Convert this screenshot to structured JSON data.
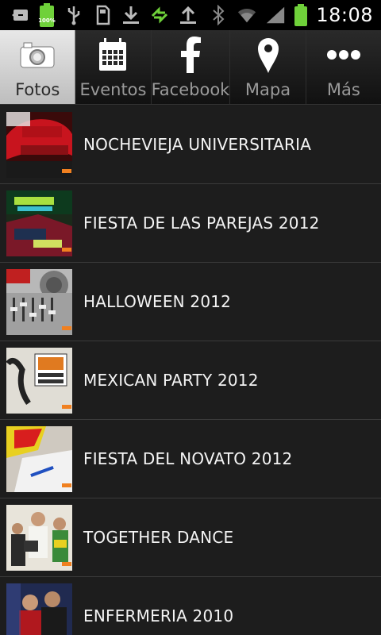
{
  "status_bar": {
    "time": "18:08",
    "battery_percent": "100%",
    "icons": [
      "back-arrow-icon",
      "battery-full-icon",
      "usb-icon",
      "sd-card-icon",
      "download-icon",
      "sync-icon",
      "upload-icon",
      "bluetooth-icon",
      "wifi-icon",
      "signal-icon",
      "battery-icon"
    ]
  },
  "tabs": [
    {
      "label": "Fotos",
      "icon": "camera-icon",
      "active": true
    },
    {
      "label": "Eventos",
      "icon": "calendar-icon",
      "active": false
    },
    {
      "label": "Facebook",
      "icon": "facebook-icon",
      "active": false
    },
    {
      "label": "Mapa",
      "icon": "map-pin-icon",
      "active": false
    },
    {
      "label": "Más",
      "icon": "more-dots-icon",
      "active": false
    }
  ],
  "albums": [
    {
      "title": "NOCHEVIEJA UNIVERSITARIA"
    },
    {
      "title": "FIESTA DE LAS PAREJAS 2012"
    },
    {
      "title": "HALLOWEEN 2012"
    },
    {
      "title": "MEXICAN PARTY 2012"
    },
    {
      "title": "FIESTA DEL NOVATO 2012"
    },
    {
      "title": "TOGETHER DANCE"
    },
    {
      "title": "ENFERMERIA 2010"
    }
  ],
  "colors": {
    "accent_green": "#6fd13a",
    "active_tab_bg": "#d6d6d6",
    "row_bg": "#1d1d1d",
    "divider": "#3a3a3a"
  }
}
